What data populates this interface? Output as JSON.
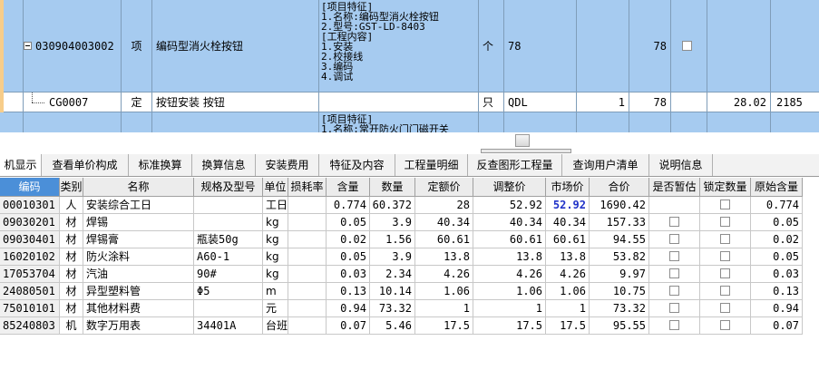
{
  "top_rows": [
    {
      "code": "030904003002",
      "category": "项",
      "name": "编码型消火栓按钮",
      "features": [
        "[项目特征]",
        "1.名称:编码型消火栓按钮",
        "2.型号:GST-LD-8403",
        "[工程内容]",
        "1.安装",
        "2.校接线",
        "3.编码",
        "4.调试"
      ],
      "unit": "个",
      "quantity_expr": "78",
      "quantity": "78"
    },
    {
      "code": "CG0007",
      "category": "定",
      "name": "按钮安装 按钮",
      "unit": "只",
      "quantity_expr": "QDL",
      "factor": "1",
      "quantity": "78",
      "unit_price": "28.02",
      "total_price": "2185"
    },
    {
      "features": [
        "[项目特征]",
        "1.名称:常开防火门门磁开关"
      ]
    }
  ],
  "tabs": [
    {
      "label": "机显示",
      "active": true
    },
    {
      "label": "查看单价构成"
    },
    {
      "label": "标准换算"
    },
    {
      "label": "换算信息"
    },
    {
      "label": "安装费用"
    },
    {
      "label": "特征及内容"
    },
    {
      "label": "工程量明细"
    },
    {
      "label": "反查图形工程量"
    },
    {
      "label": "查询用户清单"
    },
    {
      "label": "说明信息"
    }
  ],
  "lower_table": {
    "columns": [
      "编码",
      "类别",
      "名称",
      "规格及型号",
      "单位",
      "损耗率",
      "含量",
      "数量",
      "定额价",
      "调整价",
      "市场价",
      "合价",
      "是否暂估",
      "锁定数量",
      "原始含量"
    ],
    "rows": [
      {
        "code": "00010301",
        "type": "人",
        "name": "安装综合工日",
        "spec": "",
        "unit": "工日",
        "loss": "",
        "content": "0.774",
        "qty": "60.372",
        "quota": "28",
        "adjusted": "52.92",
        "market": "52.92",
        "total": "1690.42",
        "provisional": false,
        "locked": false,
        "original": "0.774"
      },
      {
        "code": "09030201",
        "type": "材",
        "name": "焊锡",
        "spec": "",
        "unit": "kg",
        "loss": "",
        "content": "0.05",
        "qty": "3.9",
        "quota": "40.34",
        "adjusted": "40.34",
        "market": "40.34",
        "total": "157.33",
        "provisional": false,
        "locked": false,
        "original": "0.05"
      },
      {
        "code": "09030401",
        "type": "材",
        "name": "焊锡膏",
        "spec": "瓶装50g",
        "unit": "kg",
        "loss": "",
        "content": "0.02",
        "qty": "1.56",
        "quota": "60.61",
        "adjusted": "60.61",
        "market": "60.61",
        "total": "94.55",
        "provisional": false,
        "locked": false,
        "original": "0.02"
      },
      {
        "code": "16020102",
        "type": "材",
        "name": "防火涂料",
        "spec": "A60-1",
        "unit": "kg",
        "loss": "",
        "content": "0.05",
        "qty": "3.9",
        "quota": "13.8",
        "adjusted": "13.8",
        "market": "13.8",
        "total": "53.82",
        "provisional": false,
        "locked": false,
        "original": "0.05"
      },
      {
        "code": "17053704",
        "type": "材",
        "name": "汽油",
        "spec": "90#",
        "unit": "kg",
        "loss": "",
        "content": "0.03",
        "qty": "2.34",
        "quota": "4.26",
        "adjusted": "4.26",
        "market": "4.26",
        "total": "9.97",
        "provisional": false,
        "locked": false,
        "original": "0.03"
      },
      {
        "code": "24080501",
        "type": "材",
        "name": "异型塑料管",
        "spec": "Φ5",
        "unit": "m",
        "loss": "",
        "content": "0.13",
        "qty": "10.14",
        "quota": "1.06",
        "adjusted": "1.06",
        "market": "1.06",
        "total": "10.75",
        "provisional": false,
        "locked": false,
        "original": "0.13"
      },
      {
        "code": "75010101",
        "type": "材",
        "name": "其他材料费",
        "spec": "",
        "unit": "元",
        "loss": "",
        "content": "0.94",
        "qty": "73.32",
        "quota": "1",
        "adjusted": "1",
        "market": "1",
        "total": "73.32",
        "provisional": false,
        "locked": false,
        "original": "0.94"
      },
      {
        "code": "85240803",
        "type": "机",
        "name": "数字万用表",
        "spec": "34401A",
        "unit": "台班",
        "loss": "",
        "content": "0.07",
        "qty": "5.46",
        "quota": "17.5",
        "adjusted": "17.5",
        "market": "17.5",
        "total": "95.55",
        "provisional": false,
        "locked": false,
        "original": "0.07"
      }
    ]
  },
  "colors": {
    "row_blue": "#a6cbf0",
    "header_selected": "#4b8fd8",
    "market_price": "#2032c8",
    "row_marker": "#f7cd8a"
  }
}
